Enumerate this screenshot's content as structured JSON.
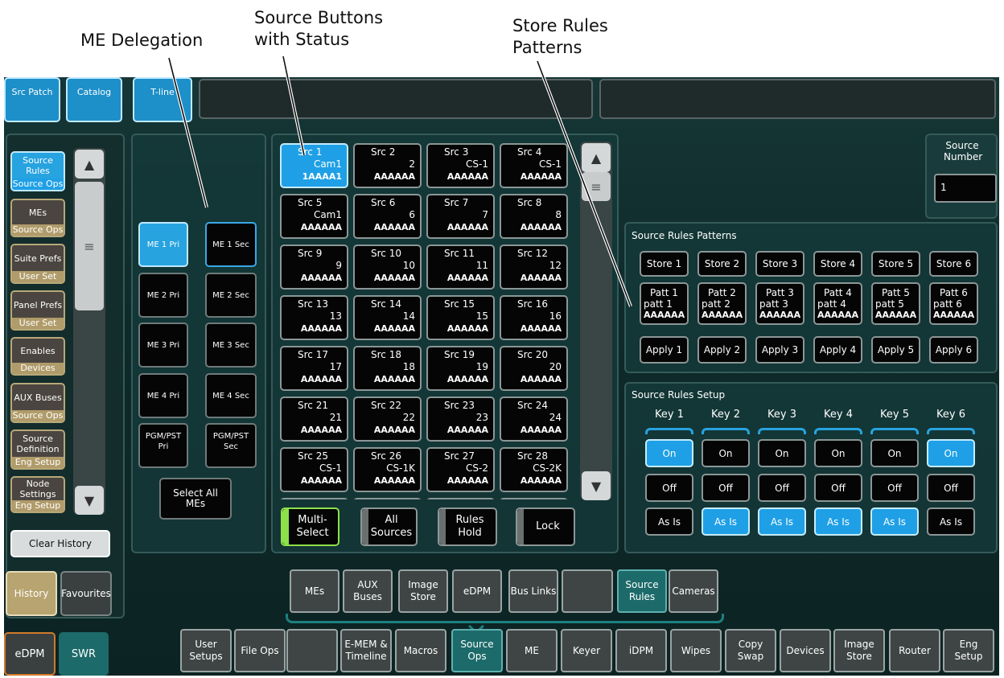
{
  "callouts": {
    "me_delegation": "ME Delegation",
    "source_buttons_1": "Source Buttons",
    "source_buttons_2": "with Status",
    "store_rules_1": "Store Rules",
    "store_rules_2": "Patterns"
  },
  "top_tabs": [
    "Src Patch",
    "Catalog",
    "T-line"
  ],
  "history_list": [
    {
      "title": "Source Rules",
      "sub": "Source Ops",
      "active": true
    },
    {
      "title": "MEs",
      "sub": "Source Ops"
    },
    {
      "title": "Suite Prefs",
      "sub": "User Set"
    },
    {
      "title": "Panel Prefs",
      "sub": "User Set"
    },
    {
      "title": "Enables",
      "sub": "Devices"
    },
    {
      "title": "AUX Buses",
      "sub": "Source Ops"
    },
    {
      "title": "Source Definition",
      "sub": "Eng Setup"
    },
    {
      "title": "Node Settings",
      "sub": "Eng Setup"
    }
  ],
  "clear_history": "Clear History",
  "history_tab": "History",
  "favourites_tab": "Favourites",
  "edpm_btn": "eDPM",
  "swr_btn": "SWR",
  "me_buttons": [
    {
      "pri": "ME 1 Pri",
      "sec": "ME 1 Sec"
    },
    {
      "pri": "ME 2 Pri",
      "sec": "ME 2 Sec"
    },
    {
      "pri": "ME 3 Pri",
      "sec": "ME 3 Sec"
    },
    {
      "pri": "ME 4 Pri",
      "sec": "ME 4 Sec"
    },
    {
      "pri": "PGM/PST Pri",
      "sec": "PGM/PST Sec"
    }
  ],
  "select_all_mes": "Select All MEs",
  "sources": [
    {
      "name": "Src 1",
      "val": "Cam1",
      "pat": "1AAAA1"
    },
    {
      "name": "Src 2",
      "val": "2",
      "pat": "AAAAAA"
    },
    {
      "name": "Src 3",
      "val": "CS-1",
      "pat": "AAAAAA"
    },
    {
      "name": "Src 4",
      "val": "CS-1",
      "pat": "AAAAAA"
    },
    {
      "name": "Src 5",
      "val": "Cam1",
      "pat": "AAAAAA"
    },
    {
      "name": "Src 6",
      "val": "6",
      "pat": "AAAAAA"
    },
    {
      "name": "Src 7",
      "val": "7",
      "pat": "AAAAAA"
    },
    {
      "name": "Src 8",
      "val": "8",
      "pat": "AAAAAA"
    },
    {
      "name": "Src 9",
      "val": "9",
      "pat": "AAAAAA"
    },
    {
      "name": "Src 10",
      "val": "10",
      "pat": "AAAAAA"
    },
    {
      "name": "Src 11",
      "val": "11",
      "pat": "AAAAAA"
    },
    {
      "name": "Src 12",
      "val": "12",
      "pat": "AAAAAA"
    },
    {
      "name": "Src 13",
      "val": "13",
      "pat": "AAAAAA"
    },
    {
      "name": "Src 14",
      "val": "14",
      "pat": "AAAAAA"
    },
    {
      "name": "Src 15",
      "val": "15",
      "pat": "AAAAAA"
    },
    {
      "name": "Src 16",
      "val": "16",
      "pat": "AAAAAA"
    },
    {
      "name": "Src 17",
      "val": "17",
      "pat": "AAAAAA"
    },
    {
      "name": "Src 18",
      "val": "18",
      "pat": "AAAAAA"
    },
    {
      "name": "Src 19",
      "val": "19",
      "pat": "AAAAAA"
    },
    {
      "name": "Src 20",
      "val": "20",
      "pat": "AAAAAA"
    },
    {
      "name": "Src 21",
      "val": "21",
      "pat": "AAAAAA"
    },
    {
      "name": "Src 22",
      "val": "22",
      "pat": "AAAAAA"
    },
    {
      "name": "Src 23",
      "val": "23",
      "pat": "AAAAAA"
    },
    {
      "name": "Src 24",
      "val": "24",
      "pat": "AAAAAA"
    },
    {
      "name": "Src 25",
      "val": "CS-1",
      "pat": "AAAAAA"
    },
    {
      "name": "Src 26",
      "val": "CS-1K",
      "pat": "AAAAAA"
    },
    {
      "name": "Src 27",
      "val": "CS-2",
      "pat": "AAAAAA"
    },
    {
      "name": "Src 28",
      "val": "CS-2K",
      "pat": "AAAAAA"
    }
  ],
  "source_controls": [
    "Multi-Select",
    "All Sources",
    "Rules Hold",
    "Lock"
  ],
  "source_number": {
    "label": "Source Number",
    "value": "1"
  },
  "rules_patterns": {
    "title": "Source Rules Patterns",
    "store": [
      "Store 1",
      "Store 2",
      "Store 3",
      "Store 4",
      "Store 5",
      "Store 6"
    ],
    "patt": [
      {
        "l1": "Patt 1",
        "l2": "patt 1",
        "l3": "AAAAAA"
      },
      {
        "l1": "Patt 2",
        "l2": "patt 2",
        "l3": "AAAAAA"
      },
      {
        "l1": "Patt 3",
        "l2": "patt 3",
        "l3": "AAAAAA"
      },
      {
        "l1": "Patt 4",
        "l2": "patt 4",
        "l3": "AAAAAA"
      },
      {
        "l1": "Patt 5",
        "l2": "patt 5",
        "l3": "AAAAAA"
      },
      {
        "l1": "Patt 6",
        "l2": "patt 6",
        "l3": "AAAAAA"
      }
    ],
    "apply": [
      "Apply 1",
      "Apply 2",
      "Apply 3",
      "Apply 4",
      "Apply 5",
      "Apply 6"
    ]
  },
  "rules_setup": {
    "title": "Source Rules Setup",
    "keys": [
      "Key 1",
      "Key 2",
      "Key 3",
      "Key 4",
      "Key 5",
      "Key 6"
    ],
    "on": "On",
    "off": "Off",
    "asis": "As Is"
  },
  "sub_nav": [
    "MEs",
    "AUX Buses",
    "Image Store",
    "eDPM",
    "Bus Links",
    "",
    "Source Rules",
    "Cameras"
  ],
  "main_nav": [
    "User Setups",
    "File Ops",
    "",
    "E-MEM & Timeline",
    "Macros",
    "Source Ops",
    "ME",
    "Keyer",
    "iDPM",
    "Wipes",
    "Copy Swap",
    "Devices",
    "Image Store",
    "Router",
    "Eng Setup"
  ]
}
